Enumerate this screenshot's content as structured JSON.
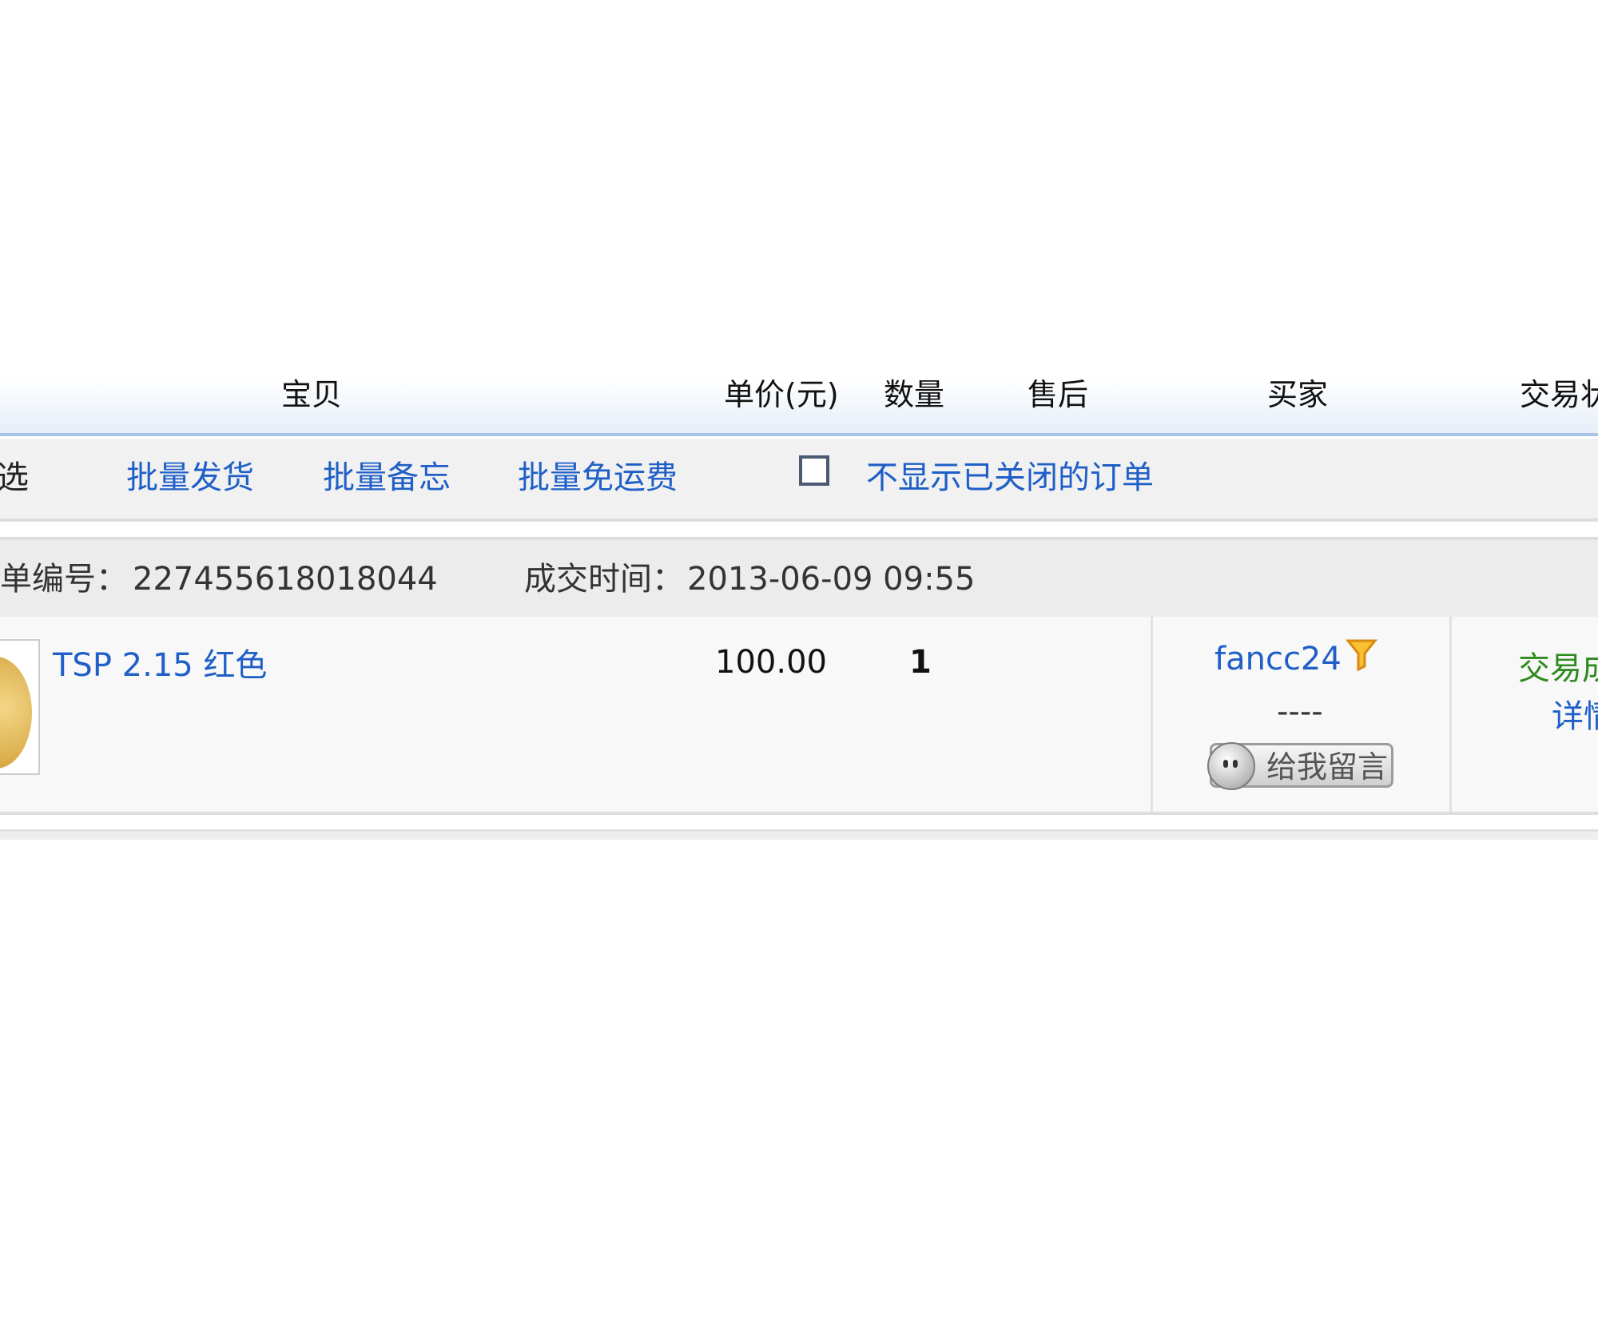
{
  "table_header": {
    "item": "宝贝",
    "unit_price": "单价(元)",
    "quantity": "数量",
    "after_sale": "售后",
    "buyer": "买家",
    "trade_status": "交易状"
  },
  "toolbar": {
    "select_all_partial": "选",
    "batch_ship": "批量发货",
    "batch_memo": "批量备忘",
    "batch_free_shipping": "批量免运费",
    "hide_closed_orders": "不显示已关闭的订单",
    "hide_closed_checked": false
  },
  "order": {
    "number_label": "单编号：",
    "number": "227455618018044",
    "time_label": "成交时间：",
    "time": "2013-06-09 09:55",
    "item_title": "TSP 2.15 红色",
    "price": "100.00",
    "quantity": "1",
    "buyer_name": "fancc24",
    "buyer_extra": "----",
    "message_button": "给我留言",
    "status": "交易成",
    "detail_link": "详情"
  },
  "icons": {
    "filter": "filter-icon",
    "message": "chat-face-icon"
  },
  "colors": {
    "link": "#1f5fc7",
    "status_success": "#2e8b1e",
    "header_border": "#a9c4e6",
    "filter_icon": "#f0a020"
  }
}
